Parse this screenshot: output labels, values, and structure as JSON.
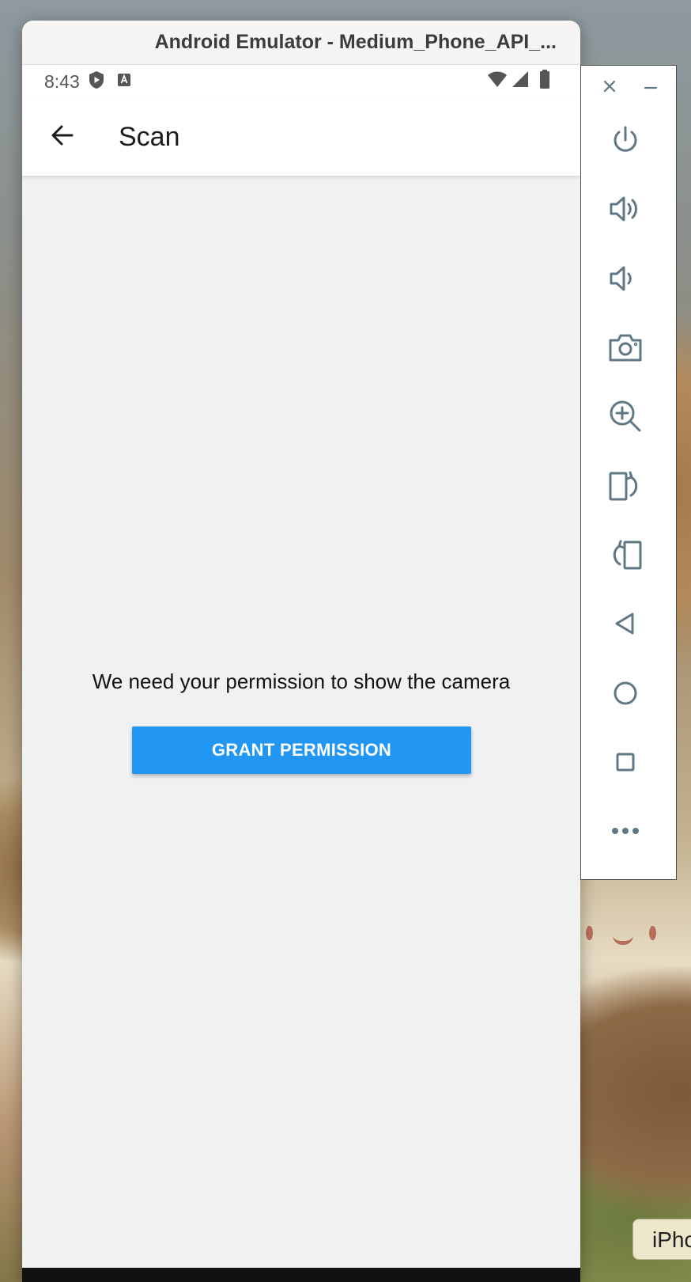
{
  "window": {
    "title": "Android Emulator - Medium_Phone_API_..."
  },
  "status_bar": {
    "time": "8:43",
    "icons": [
      "play-protect-icon",
      "keyboard-a-icon",
      "wifi-icon",
      "signal-icon",
      "battery-icon"
    ]
  },
  "app_bar": {
    "title": "Scan",
    "back_icon": "arrow-left-icon"
  },
  "main": {
    "permission_text": "We need your permission to show the camera",
    "grant_button_label": "GRANT PERMISSION"
  },
  "side_toolbar": {
    "buttons": [
      "close-icon",
      "minimize-icon",
      "power-icon",
      "volume-up-icon",
      "volume-down-icon",
      "camera-icon",
      "zoom-icon",
      "rotate-left-icon",
      "rotate-right-icon",
      "back-nav-icon",
      "home-nav-icon",
      "overview-nav-icon",
      "more-icon"
    ]
  },
  "taskbar": {
    "iphone_tab_label": "iPhc"
  },
  "colors": {
    "accent": "#2196f3",
    "toolbar_icon": "#5f7884",
    "content_bg": "#f1f1f1"
  }
}
